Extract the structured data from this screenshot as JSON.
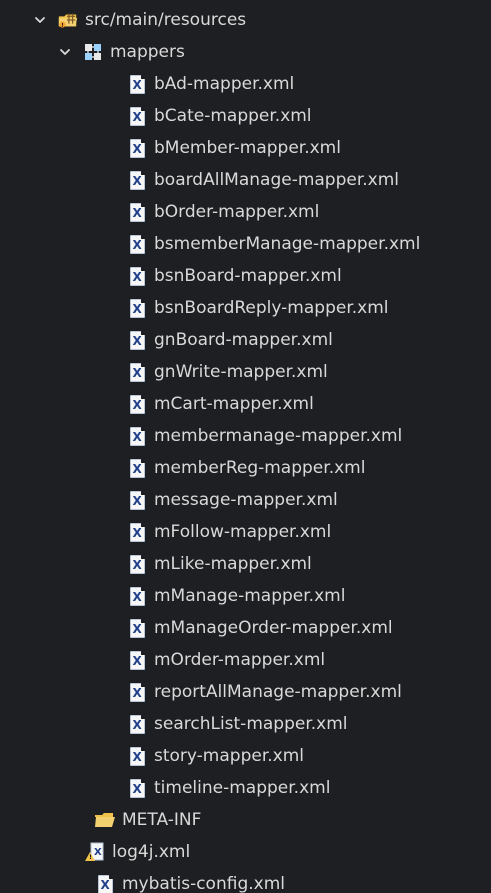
{
  "tree": {
    "root": {
      "label": "src/main/resources",
      "icon": "resource-folder-icon"
    },
    "mappers": {
      "label": "mappers",
      "icon": "package-icon"
    },
    "files": [
      "bAd-mapper.xml",
      "bCate-mapper.xml",
      "bMember-mapper.xml",
      "boardAllManage-mapper.xml",
      "bOrder-mapper.xml",
      "bsmemberManage-mapper.xml",
      "bsnBoard-mapper.xml",
      "bsnBoardReply-mapper.xml",
      "gnBoard-mapper.xml",
      "gnWrite-mapper.xml",
      "mCart-mapper.xml",
      "membermanage-mapper.xml",
      "memberReg-mapper.xml",
      "message-mapper.xml",
      "mFollow-mapper.xml",
      "mLike-mapper.xml",
      "mManage-mapper.xml",
      "mManageOrder-mapper.xml",
      "mOrder-mapper.xml",
      "reportAllManage-mapper.xml",
      "searchList-mapper.xml",
      "story-mapper.xml",
      "timeline-mapper.xml"
    ],
    "meta_inf": {
      "label": "META-INF",
      "icon": "folder-open-icon"
    },
    "log4j": {
      "label": "log4j.xml",
      "icon": "xml-warning-icon"
    },
    "mybatis": {
      "label": "mybatis-config.xml",
      "icon": "xml-file-icon"
    }
  },
  "colors": {
    "background": "#1e1f22",
    "text": "#d9d9d9",
    "xml_icon_blue": "#1f3f88",
    "folder_yellow": "#f0c14b"
  }
}
